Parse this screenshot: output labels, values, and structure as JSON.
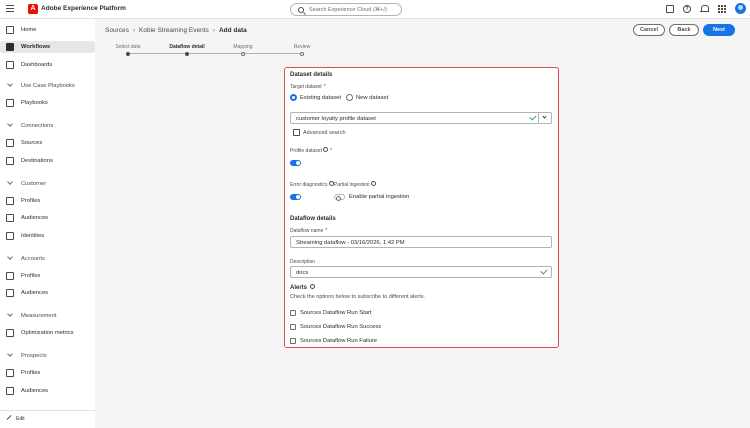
{
  "header": {
    "logo_letter": "A",
    "app_title": "Adobe Experience Platform",
    "search_placeholder": "Search Experience Cloud (⌘+/)",
    "help_glyph": "?"
  },
  "sidebar": {
    "items": [
      {
        "label": "Home",
        "icon": "home-icon"
      },
      {
        "label": "Workflows",
        "icon": "workflows-icon",
        "active": true
      },
      {
        "label": "Dashboards",
        "icon": "dashboards-icon"
      }
    ],
    "sections": [
      {
        "title": "Use Case Playbooks",
        "items": [
          "Playbooks"
        ]
      },
      {
        "title": "Connections",
        "items": [
          "Sources",
          "Destinations"
        ]
      },
      {
        "title": "Customer",
        "items": [
          "Profiles",
          "Audiences",
          "Identities"
        ]
      },
      {
        "title": "Accounts",
        "items": [
          "Profiles",
          "Audiences"
        ]
      },
      {
        "title": "Measurement",
        "items": [
          "Optimization metrics"
        ]
      },
      {
        "title": "Prospects",
        "items": [
          "Profiles",
          "Audiences"
        ]
      }
    ],
    "footer_label": "Edit"
  },
  "breadcrumb": {
    "items": [
      "Sources",
      "Kobie Streaming Events"
    ],
    "current": "Add data",
    "separator": "›"
  },
  "actions": {
    "cancel": "Cancel",
    "back": "Back",
    "next": "Next"
  },
  "steps": [
    {
      "label": "Select data",
      "state": "done"
    },
    {
      "label": "Dataflow detail",
      "state": "current"
    },
    {
      "label": "Mapping",
      "state": "todo"
    },
    {
      "label": "Review",
      "state": "todo"
    }
  ],
  "dataset_details": {
    "title": "Dataset details",
    "target_label": "Target dataset",
    "required_mark": "*",
    "options": [
      "Existing dataset",
      "New dataset"
    ],
    "selected_option": "Existing dataset",
    "dataset_value": "customer loyalty profile dataset",
    "advanced_search": "Advanced search",
    "profile_label": "Profile dataset",
    "profile_enabled": true,
    "error_diag_label": "Error diagnostics",
    "error_diag_enabled": true,
    "partial_label": "Partial ingestion",
    "partial_toggle_label": "Enable partial ingestion",
    "partial_enabled": false
  },
  "dataflow_details": {
    "title": "Dataflow details",
    "name_label": "Dataflow name",
    "required_mark": "*",
    "name_value": "Streaming dataflow - 03/16/2026, 1:42 PM",
    "description_label": "Description",
    "description_value": "docs"
  },
  "alerts": {
    "title": "Alerts",
    "help": "Check the options below to subscribe to different alerts.",
    "options": [
      "Sources Dataflow Run Start",
      "Sources Dataflow Run Success",
      "Sources Dataflow Run Failure"
    ]
  },
  "colors": {
    "accent": "#1473e6",
    "highlight_border": "#e34850",
    "success": "#2d9d78",
    "brand": "#eb1000"
  }
}
